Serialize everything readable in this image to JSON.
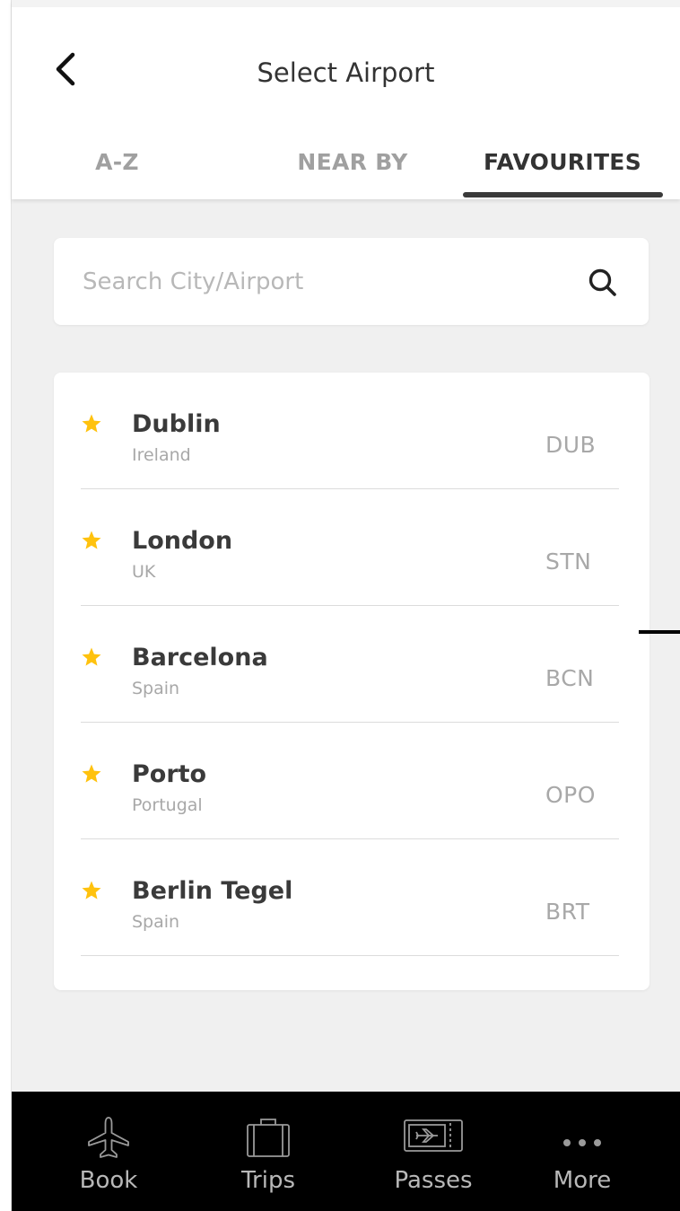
{
  "header": {
    "back_icon": "chevron-left-icon",
    "title": "Select Airport",
    "tabs": [
      {
        "label": "A-Z",
        "active": false
      },
      {
        "label": "NEAR BY",
        "active": false
      },
      {
        "label": "FAVOURITES",
        "active": true
      }
    ]
  },
  "search": {
    "placeholder": "Search City/Airport",
    "value": "",
    "icon": "search-icon"
  },
  "favourites": [
    {
      "city": "Dublin",
      "country": "Ireland",
      "code": "DUB",
      "icon": "star-icon"
    },
    {
      "city": "London",
      "country": "UK",
      "code": "STN",
      "icon": "star-icon"
    },
    {
      "city": "Barcelona",
      "country": "Spain",
      "code": "BCN",
      "icon": "star-icon"
    },
    {
      "city": "Porto",
      "country": "Portugal",
      "code": "OPO",
      "icon": "star-icon"
    },
    {
      "city": "Berlin Tegel",
      "country": "Spain",
      "code": "BRT",
      "icon": "star-icon"
    }
  ],
  "bottom_nav": [
    {
      "label": "Book",
      "icon": "airplane-icon"
    },
    {
      "label": "Trips",
      "icon": "suitcase-icon"
    },
    {
      "label": "Passes",
      "icon": "boarding-pass-icon"
    },
    {
      "label": "More",
      "icon": "more-dots-icon"
    }
  ],
  "colors": {
    "star": "#FFC20E",
    "active_tab": "#333333",
    "inactive_tab": "#A0A0A0",
    "nav_background": "#000000",
    "page_background": "#F0F0F0"
  }
}
